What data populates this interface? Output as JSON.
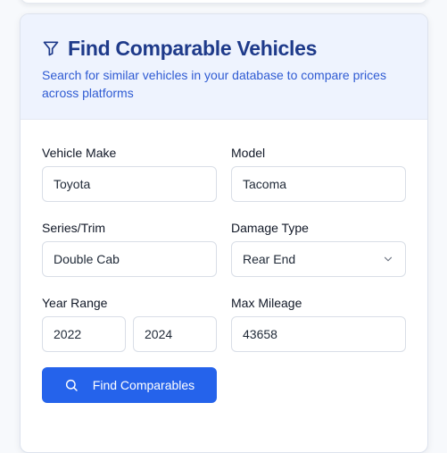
{
  "header": {
    "title": "Find Comparable Vehicles",
    "subtitle": "Search for similar vehicles in your database to compare prices across platforms"
  },
  "form": {
    "make": {
      "label": "Vehicle Make",
      "value": "Toyota"
    },
    "model": {
      "label": "Model",
      "value": "Tacoma"
    },
    "series": {
      "label": "Series/Trim",
      "value": "Double Cab"
    },
    "damage": {
      "label": "Damage Type",
      "value": "Rear End"
    },
    "year": {
      "label": "Year Range",
      "from": "2022",
      "to": "2024"
    },
    "mileage": {
      "label": "Max Mileage",
      "value": "43658"
    }
  },
  "actions": {
    "search_label": "Find Comparables"
  },
  "colors": {
    "accent": "#2563eb",
    "title": "#1e3a8a",
    "header_bg": "#eef3fe"
  },
  "icons": {
    "title": "filter-icon",
    "button": "search-icon",
    "select": "chevron-down-icon"
  }
}
